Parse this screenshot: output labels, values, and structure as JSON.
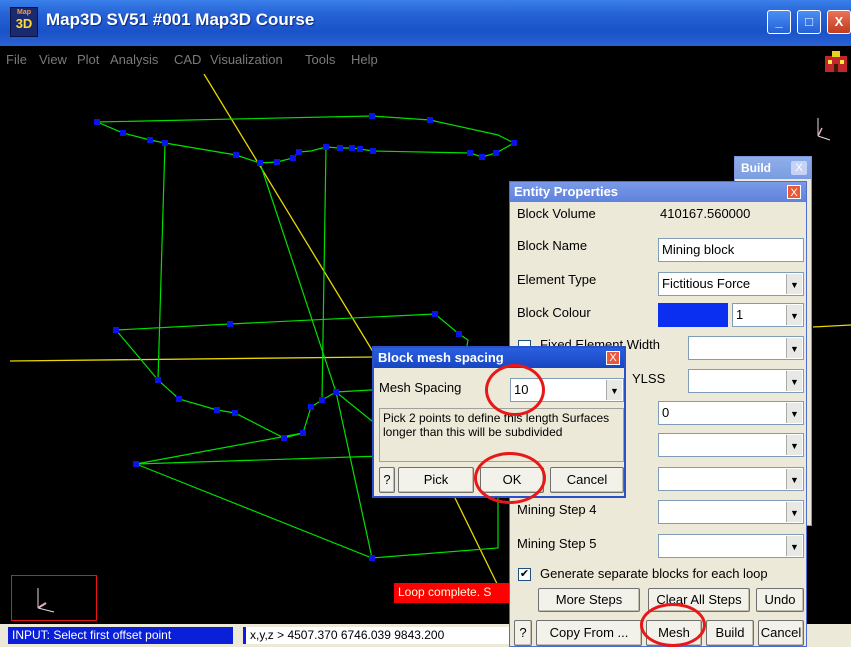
{
  "window": {
    "title": "Map3D SV51 #001  Map3D Course",
    "logo_text_top": "Map",
    "logo_text": "3D",
    "controls": {
      "minimize": "_",
      "maximize": "□",
      "close": "X"
    }
  },
  "menu": [
    "File",
    "View",
    "Plot",
    "Analysis",
    "CAD",
    "Visualization",
    "Tools",
    "Help"
  ],
  "canvas": {
    "loop_message": "Loop complete. S"
  },
  "statusbar": {
    "input_text": "INPUT: Select first offset point",
    "coords_text": "x,y,z >  4507.370  6746.039  9843.200"
  },
  "build_panel": {
    "title": "Build",
    "close": "X"
  },
  "entity_properties": {
    "title": "Entity Properties",
    "close": "X",
    "block_volume_label": "Block Volume",
    "block_volume_value": "410167.560000",
    "block_name_label": "Block Name",
    "block_name_value": "Mining block",
    "element_type_label": "Element Type",
    "element_type_value": "Fictitious Force",
    "block_colour_label": "Block Colour",
    "block_colour_swatch": "#0a2ff0",
    "block_colour_value": "1",
    "fixed_width_label": "Fixed Element Width",
    "ylss_label": "YLSS",
    "step_value": "0",
    "mining_step4_label": "Mining Step  4",
    "mining_step5_label": "Mining Step  5",
    "generate_label": "Generate separate blocks for each loop",
    "generate_checked": "✔",
    "buttons": {
      "more_steps": "More Steps",
      "clear_all_steps": "Clear All Steps",
      "undo": "Undo",
      "help": "?",
      "copy_from": "Copy From ...",
      "mesh": "Mesh",
      "build": "Build",
      "cancel": "Cancel"
    }
  },
  "mesh_dialog": {
    "title": "Block mesh spacing",
    "close": "X",
    "spacing_label": "Mesh Spacing",
    "spacing_value": "10",
    "hint": "Pick 2 points to define this length Surfaces longer than this will be subdivided",
    "buttons": {
      "help": "?",
      "pick": "Pick",
      "ok": "OK",
      "cancel": "Cancel"
    }
  },
  "colors": {
    "wire": "#00e000",
    "node": "#0a14e8",
    "axis_line": "#e6d800",
    "highlight_ring": "#e81818"
  }
}
